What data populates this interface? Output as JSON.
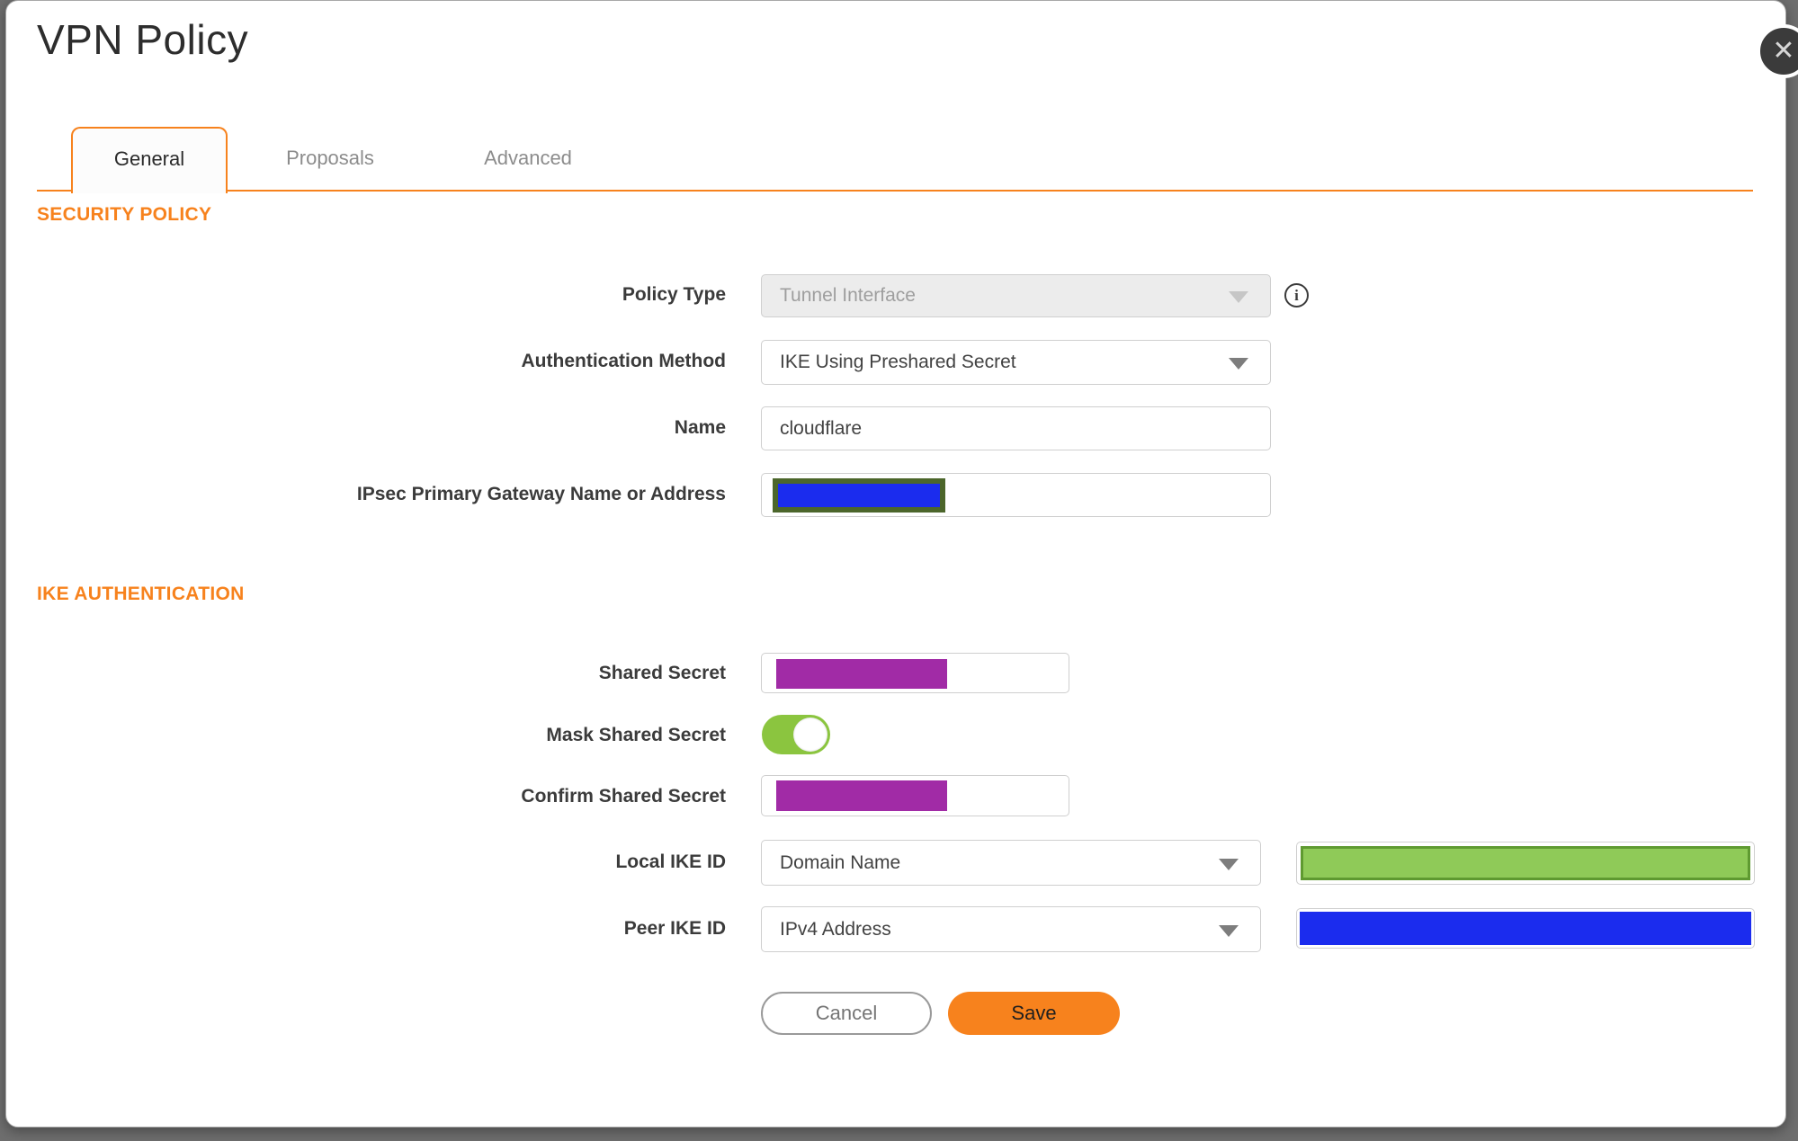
{
  "dialog": {
    "title": "VPN Policy",
    "close_icon": "✕"
  },
  "tabs": [
    {
      "label": "General",
      "active": true
    },
    {
      "label": "Proposals",
      "active": false
    },
    {
      "label": "Advanced",
      "active": false
    }
  ],
  "security_policy": {
    "heading": "SECURITY POLICY",
    "policy_type": {
      "label": "Policy Type",
      "value": "Tunnel Interface",
      "disabled": true,
      "info_icon": "i"
    },
    "authentication_method": {
      "label": "Authentication Method",
      "value": "IKE Using Preshared Secret"
    },
    "name": {
      "label": "Name",
      "value": "cloudflare"
    },
    "gateway": {
      "label": "IPsec Primary Gateway Name or Address",
      "value": "",
      "redacted": true
    }
  },
  "ike_authentication": {
    "heading": "IKE AUTHENTICATION",
    "shared_secret": {
      "label": "Shared Secret",
      "value": "",
      "redacted": true
    },
    "mask_shared_secret": {
      "label": "Mask Shared Secret",
      "toggle_state": "on"
    },
    "confirm_shared_secret": {
      "label": "Confirm Shared Secret",
      "value": "",
      "redacted": true
    },
    "local_ike_id": {
      "label": "Local IKE ID",
      "type_value": "Domain Name",
      "value": "",
      "value_redacted": true
    },
    "peer_ike_id": {
      "label": "Peer IKE ID",
      "type_value": "IPv4 Address",
      "value": "",
      "value_redacted": true
    }
  },
  "actions": {
    "cancel_label": "Cancel",
    "save_label": "Save"
  },
  "colors": {
    "accent_orange": "#f7821d",
    "heading_orange": "#f7821d",
    "toggle_green_on": "#8bc53f",
    "redaction_purple": "#a12ba6",
    "redaction_blue": "#1b2cee",
    "redaction_blue_border": "#4c662b",
    "redaction_green_fill": "#8fca58",
    "redaction_green_border": "#5f9a31",
    "backdrop_gray": "#6e6e6e"
  }
}
